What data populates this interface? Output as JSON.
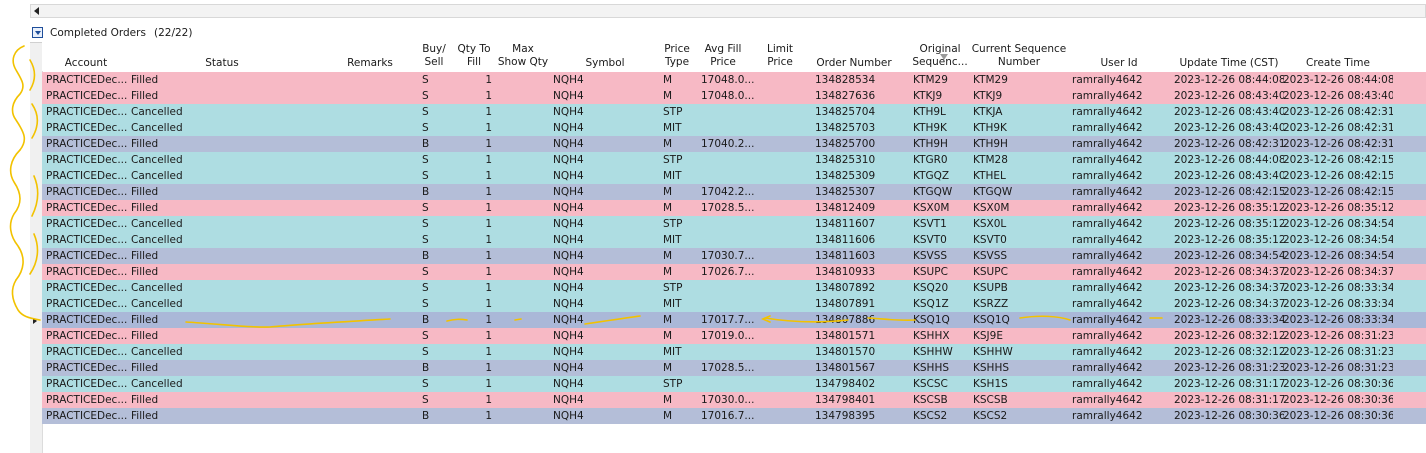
{
  "section": {
    "title": "Completed Orders",
    "count": "(22/22)"
  },
  "headers": {
    "account": "Account",
    "status": "Status",
    "remarks": "Remarks",
    "buy_sell": [
      "Buy/",
      "Sell"
    ],
    "qty_to_fill": [
      "Qty To",
      "Fill"
    ],
    "max_show_qty": [
      "Max",
      "Show Qty"
    ],
    "symbol": "Symbol",
    "price_type": [
      "Price",
      "Type"
    ],
    "avg_fill_price": [
      "Avg Fill",
      "Price"
    ],
    "limit_price": [
      "Limit",
      "Price"
    ],
    "order_number": "Order Number",
    "original_sequence": [
      "Original",
      "Sequenc..."
    ],
    "current_sequence": [
      "Current Sequence",
      "Number"
    ],
    "user_id": "User Id",
    "update_time": "Update Time (CST)",
    "create_time": "Create Time"
  },
  "selected_row": 15,
  "colors": {
    "filled_sell": "#f7b9c5",
    "filled_buy": "#b4bed8",
    "cancelled": "#aedde2",
    "annotation": "#f2c200"
  },
  "orders": [
    {
      "account": "PRACTICEDec...",
      "status": "Filled",
      "side": "S",
      "qty": "1",
      "symbol": "NQH4",
      "ptype": "M",
      "avg": "17048.0...",
      "order": "134828534",
      "orig": "KTM29",
      "curr": "KTM29",
      "user": "ramrally4642",
      "update": "2023-12-26 08:44:08",
      "create": "2023-12-26 08:44:08"
    },
    {
      "account": "PRACTICEDec...",
      "status": "Filled",
      "side": "S",
      "qty": "1",
      "symbol": "NQH4",
      "ptype": "M",
      "avg": "17048.0...",
      "order": "134827636",
      "orig": "KTKJ9",
      "curr": "KTKJ9",
      "user": "ramrally4642",
      "update": "2023-12-26 08:43:40",
      "create": "2023-12-26 08:43:40"
    },
    {
      "account": "PRACTICEDec...",
      "status": "Cancelled",
      "side": "S",
      "qty": "1",
      "symbol": "NQH4",
      "ptype": "STP",
      "avg": "",
      "order": "134825704",
      "orig": "KTH9L",
      "curr": "KTKJA",
      "user": "ramrally4642",
      "update": "2023-12-26 08:43:40",
      "create": "2023-12-26 08:42:31"
    },
    {
      "account": "PRACTICEDec...",
      "status": "Cancelled",
      "side": "S",
      "qty": "1",
      "symbol": "NQH4",
      "ptype": "MIT",
      "avg": "",
      "order": "134825703",
      "orig": "KTH9K",
      "curr": "KTH9K",
      "user": "ramrally4642",
      "update": "2023-12-26 08:43:40",
      "create": "2023-12-26 08:42:31"
    },
    {
      "account": "PRACTICEDec...",
      "status": "Filled",
      "side": "B",
      "qty": "1",
      "symbol": "NQH4",
      "ptype": "M",
      "avg": "17040.2...",
      "order": "134825700",
      "orig": "KTH9H",
      "curr": "KTH9H",
      "user": "ramrally4642",
      "update": "2023-12-26 08:42:31",
      "create": "2023-12-26 08:42:31"
    },
    {
      "account": "PRACTICEDec...",
      "status": "Cancelled",
      "side": "S",
      "qty": "1",
      "symbol": "NQH4",
      "ptype": "STP",
      "avg": "",
      "order": "134825310",
      "orig": "KTGR0",
      "curr": "KTM28",
      "user": "ramrally4642",
      "update": "2023-12-26 08:44:08",
      "create": "2023-12-26 08:42:15"
    },
    {
      "account": "PRACTICEDec...",
      "status": "Cancelled",
      "side": "S",
      "qty": "1",
      "symbol": "NQH4",
      "ptype": "MIT",
      "avg": "",
      "order": "134825309",
      "orig": "KTGQZ",
      "curr": "KTHEL",
      "user": "ramrally4642",
      "update": "2023-12-26 08:43:40",
      "create": "2023-12-26 08:42:15"
    },
    {
      "account": "PRACTICEDec...",
      "status": "Filled",
      "side": "B",
      "qty": "1",
      "symbol": "NQH4",
      "ptype": "M",
      "avg": "17042.2...",
      "order": "134825307",
      "orig": "KTGQW",
      "curr": "KTGQW",
      "user": "ramrally4642",
      "update": "2023-12-26 08:42:15",
      "create": "2023-12-26 08:42:15"
    },
    {
      "account": "PRACTICEDec...",
      "status": "Filled",
      "side": "S",
      "qty": "1",
      "symbol": "NQH4",
      "ptype": "M",
      "avg": "17028.5...",
      "order": "134812409",
      "orig": "KSX0M",
      "curr": "KSX0M",
      "user": "ramrally4642",
      "update": "2023-12-26 08:35:12",
      "create": "2023-12-26 08:35:12"
    },
    {
      "account": "PRACTICEDec...",
      "status": "Cancelled",
      "side": "S",
      "qty": "1",
      "symbol": "NQH4",
      "ptype": "STP",
      "avg": "",
      "order": "134811607",
      "orig": "KSVT1",
      "curr": "KSX0L",
      "user": "ramrally4642",
      "update": "2023-12-26 08:35:12",
      "create": "2023-12-26 08:34:54"
    },
    {
      "account": "PRACTICEDec...",
      "status": "Cancelled",
      "side": "S",
      "qty": "1",
      "symbol": "NQH4",
      "ptype": "MIT",
      "avg": "",
      "order": "134811606",
      "orig": "KSVT0",
      "curr": "KSVT0",
      "user": "ramrally4642",
      "update": "2023-12-26 08:35:12",
      "create": "2023-12-26 08:34:54"
    },
    {
      "account": "PRACTICEDec...",
      "status": "Filled",
      "side": "B",
      "qty": "1",
      "symbol": "NQH4",
      "ptype": "M",
      "avg": "17030.7...",
      "order": "134811603",
      "orig": "KSVSS",
      "curr": "KSVSS",
      "user": "ramrally4642",
      "update": "2023-12-26 08:34:54",
      "create": "2023-12-26 08:34:54"
    },
    {
      "account": "PRACTICEDec...",
      "status": "Filled",
      "side": "S",
      "qty": "1",
      "symbol": "NQH4",
      "ptype": "M",
      "avg": "17026.7...",
      "order": "134810933",
      "orig": "KSUPC",
      "curr": "KSUPC",
      "user": "ramrally4642",
      "update": "2023-12-26 08:34:37",
      "create": "2023-12-26 08:34:37"
    },
    {
      "account": "PRACTICEDec...",
      "status": "Cancelled",
      "side": "S",
      "qty": "1",
      "symbol": "NQH4",
      "ptype": "STP",
      "avg": "",
      "order": "134807892",
      "orig": "KSQ20",
      "curr": "KSUPB",
      "user": "ramrally4642",
      "update": "2023-12-26 08:34:37",
      "create": "2023-12-26 08:33:34"
    },
    {
      "account": "PRACTICEDec...",
      "status": "Cancelled",
      "side": "S",
      "qty": "1",
      "symbol": "NQH4",
      "ptype": "MIT",
      "avg": "",
      "order": "134807891",
      "orig": "KSQ1Z",
      "curr": "KSRZZ",
      "user": "ramrally4642",
      "update": "2023-12-26 08:34:37",
      "create": "2023-12-26 08:33:34"
    },
    {
      "account": "PRACTICEDec...",
      "status": "Filled",
      "side": "B",
      "qty": "1",
      "symbol": "NQH4",
      "ptype": "M",
      "avg": "17017.7...",
      "order": "134807886",
      "orig": "KSQ1Q",
      "curr": "KSQ1Q",
      "user": "ramrally4642",
      "update": "2023-12-26 08:33:34",
      "create": "2023-12-26 08:33:34"
    },
    {
      "account": "PRACTICEDec...",
      "status": "Filled",
      "side": "S",
      "qty": "1",
      "symbol": "NQH4",
      "ptype": "M",
      "avg": "17019.0...",
      "order": "134801571",
      "orig": "KSHHX",
      "curr": "KSJ9E",
      "user": "ramrally4642",
      "update": "2023-12-26 08:32:12",
      "create": "2023-12-26 08:31:23"
    },
    {
      "account": "PRACTICEDec...",
      "status": "Cancelled",
      "side": "S",
      "qty": "1",
      "symbol": "NQH4",
      "ptype": "MIT",
      "avg": "",
      "order": "134801570",
      "orig": "KSHHW",
      "curr": "KSHHW",
      "user": "ramrally4642",
      "update": "2023-12-26 08:32:12",
      "create": "2023-12-26 08:31:23"
    },
    {
      "account": "PRACTICEDec...",
      "status": "Filled",
      "side": "B",
      "qty": "1",
      "symbol": "NQH4",
      "ptype": "M",
      "avg": "17028.5...",
      "order": "134801567",
      "orig": "KSHHS",
      "curr": "KSHHS",
      "user": "ramrally4642",
      "update": "2023-12-26 08:31:23",
      "create": "2023-12-26 08:31:23"
    },
    {
      "account": "PRACTICEDec...",
      "status": "Cancelled",
      "side": "S",
      "qty": "1",
      "symbol": "NQH4",
      "ptype": "STP",
      "avg": "",
      "order": "134798402",
      "orig": "KSCSC",
      "curr": "KSH1S",
      "user": "ramrally4642",
      "update": "2023-12-26 08:31:17",
      "create": "2023-12-26 08:30:36"
    },
    {
      "account": "PRACTICEDec...",
      "status": "Filled",
      "side": "S",
      "qty": "1",
      "symbol": "NQH4",
      "ptype": "M",
      "avg": "17030.0...",
      "order": "134798401",
      "orig": "KSCSB",
      "curr": "KSCSB",
      "user": "ramrally4642",
      "update": "2023-12-26 08:31:17",
      "create": "2023-12-26 08:30:36"
    },
    {
      "account": "PRACTICEDec...",
      "status": "Filled",
      "side": "B",
      "qty": "1",
      "symbol": "NQH4",
      "ptype": "M",
      "avg": "17016.7...",
      "order": "134798395",
      "orig": "KSCS2",
      "curr": "KSCS2",
      "user": "ramrally4642",
      "update": "2023-12-26 08:30:36",
      "create": "2023-12-26 08:30:36"
    }
  ]
}
